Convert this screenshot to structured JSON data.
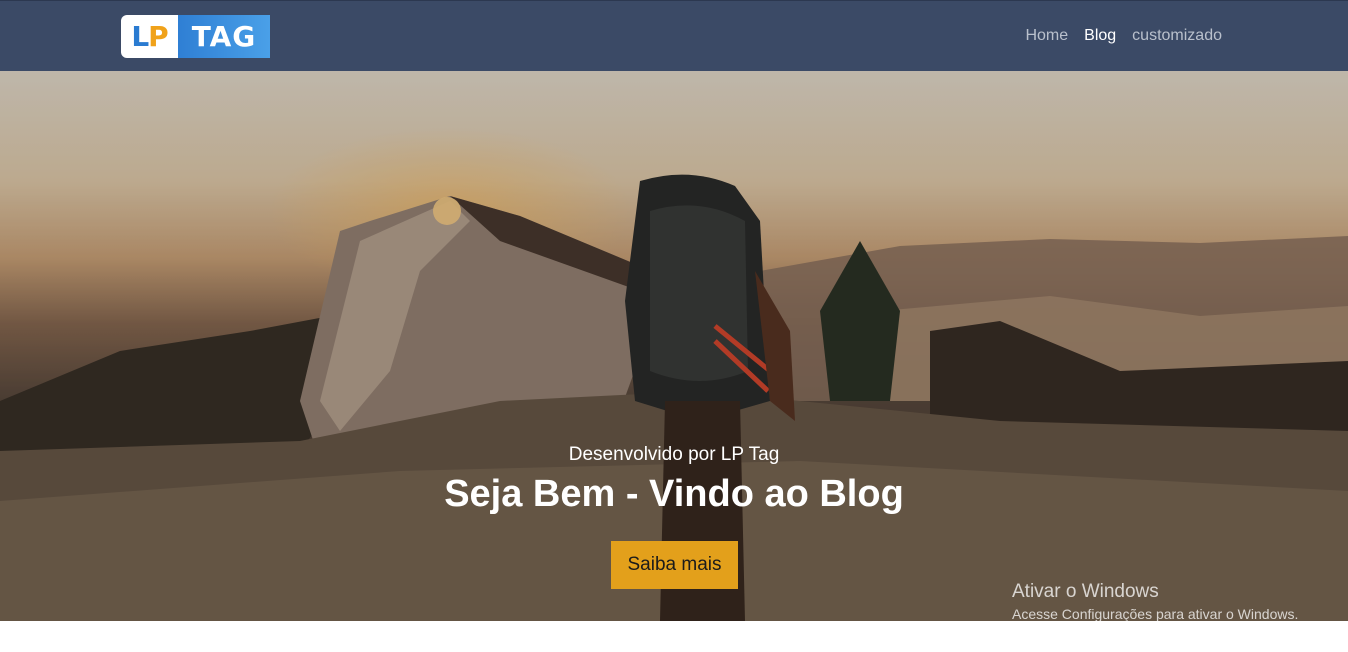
{
  "logo": {
    "lp_l": "L",
    "lp_p": "P",
    "tag": "TAG"
  },
  "nav": {
    "items": [
      {
        "label": "Home",
        "active": false
      },
      {
        "label": "Blog",
        "active": true
      },
      {
        "label": "customizado",
        "active": false
      }
    ]
  },
  "hero": {
    "subtitle": "Desenvolvido por LP Tag",
    "title": "Seja Bem - Vindo ao Blog",
    "cta_label": "Saiba mais"
  },
  "watermark": {
    "title": "Ativar o Windows",
    "subtitle": "Acesse Configurações para ativar o Windows."
  },
  "colors": {
    "navbar": "#3b4a66",
    "cta": "#e3a01b",
    "logo_blue": "#2f7fd4",
    "logo_orange": "#f0a21a"
  }
}
